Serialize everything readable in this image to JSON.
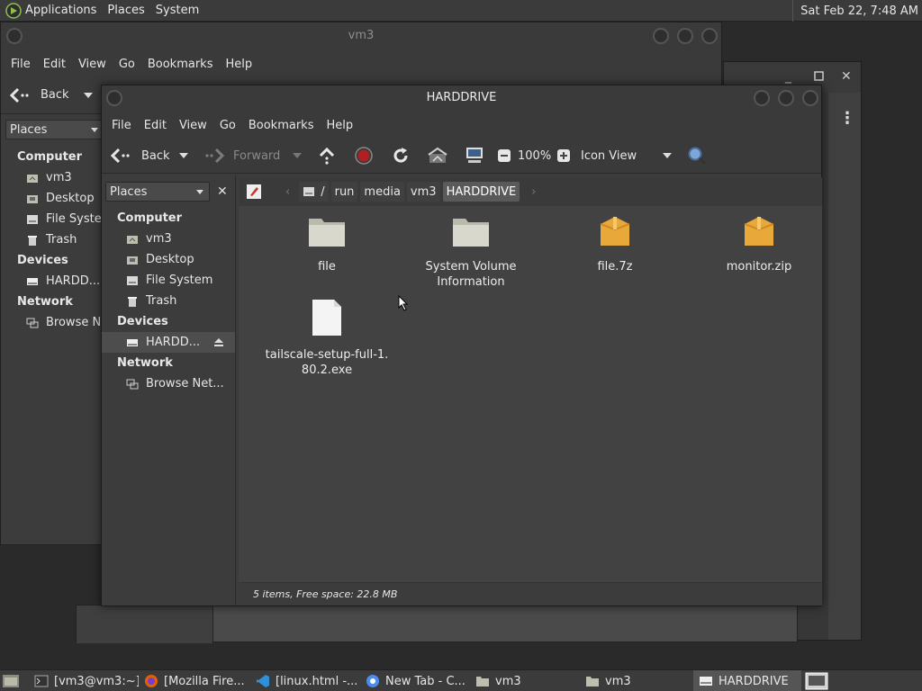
{
  "top_panel": {
    "menus": [
      "Applications",
      "Places",
      "System"
    ],
    "clock": "Sat Feb 22,  7:48 AM"
  },
  "back_window": {
    "title": "vm3",
    "menus": [
      "File",
      "Edit",
      "View",
      "Go",
      "Bookmarks",
      "Help"
    ],
    "back_label": "Back",
    "places_label": "Places",
    "sidebar": {
      "computer_heading": "Computer",
      "computer_items": [
        "vm3",
        "Desktop",
        "File System",
        "Trash"
      ],
      "devices_heading": "Devices",
      "device_items": [
        "HARDD..."
      ],
      "network_heading": "Network",
      "network_items": [
        "Browse Net"
      ]
    }
  },
  "front_window": {
    "title": "HARDDRIVE",
    "menus": [
      "File",
      "Edit",
      "View",
      "Go",
      "Bookmarks",
      "Help"
    ],
    "toolbar": {
      "back": "Back",
      "forward": "Forward",
      "zoom": "100%",
      "view_mode": "Icon View"
    },
    "places_label": "Places",
    "sidebar": {
      "computer_heading": "Computer",
      "computer_items": [
        "vm3",
        "Desktop",
        "File System",
        "Trash"
      ],
      "devices_heading": "Devices",
      "device_items": [
        "HARDD..."
      ],
      "network_heading": "Network",
      "network_items": [
        "Browse Net..."
      ]
    },
    "path": [
      "/",
      "run",
      "media",
      "vm3",
      "HARDDRIVE"
    ],
    "files": [
      {
        "name": "file",
        "type": "folder"
      },
      {
        "name": "System Volume\nInformation",
        "type": "folder"
      },
      {
        "name": "file.7z",
        "type": "archive"
      },
      {
        "name": "monitor.zip",
        "type": "archive"
      },
      {
        "name": "tailscale-setup-full-1.\n80.2.exe",
        "type": "document"
      }
    ],
    "status": "5 items, Free space: 22.8 MB"
  },
  "taskbar": {
    "tasks": [
      "[vm3@vm3:~]",
      "[Mozilla Fire...",
      "[linux.html -...",
      "New Tab - C...",
      "vm3",
      "vm3",
      "HARDDRIVE"
    ]
  },
  "colors": {
    "panel_bg": "#3b3b3b",
    "window_bg": "#3c3c3c",
    "content_bg": "#424242",
    "folder": "#d8d8cc",
    "archive": "#e8a93a",
    "stop_red": "#b02020"
  }
}
